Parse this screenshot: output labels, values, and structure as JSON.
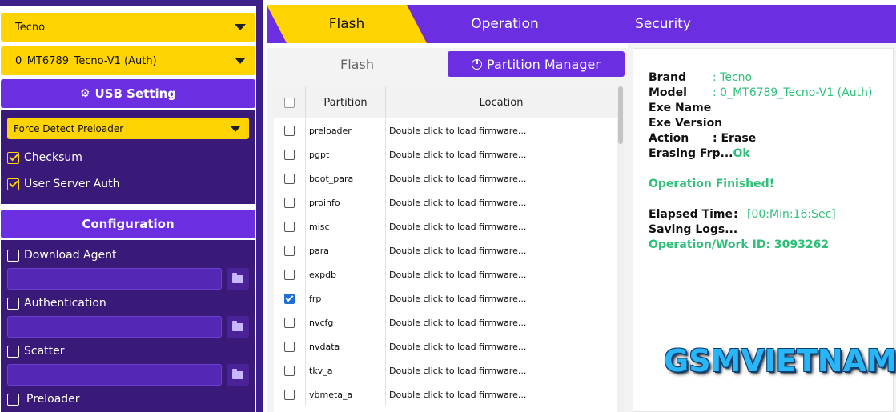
{
  "left": {
    "brand_select": "Tecno",
    "model_select": "0_MT6789_Tecno-V1 (Auth)",
    "usb_setting": "USB Setting",
    "detect_select": "Force Detect Preloader",
    "checksum": "Checksum",
    "user_server_auth": "User Server Auth",
    "configuration": "Configuration",
    "download_agent": "Download Agent",
    "authentication": "Authentication",
    "scatter": "Scatter",
    "preloader": "Preloader"
  },
  "tabs": {
    "flash": "Flash",
    "operation": "Operation",
    "security": "Security"
  },
  "subtabs": {
    "flash": "Flash",
    "partition_manager": "Partition Manager"
  },
  "table": {
    "headers": {
      "partition": "Partition",
      "location": "Location"
    },
    "rows": [
      {
        "partition": "preloader",
        "location": "Double click to load firmware...",
        "checked": false
      },
      {
        "partition": "pgpt",
        "location": "Double click to load firmware...",
        "checked": false
      },
      {
        "partition": "boot_para",
        "location": "Double click to load firmware...",
        "checked": false
      },
      {
        "partition": "proinfo",
        "location": "Double click to load firmware...",
        "checked": false
      },
      {
        "partition": "misc",
        "location": "Double click to load firmware...",
        "checked": false
      },
      {
        "partition": "para",
        "location": "Double click to load firmware...",
        "checked": false
      },
      {
        "partition": "expdb",
        "location": "Double click to load firmware...",
        "checked": false
      },
      {
        "partition": "frp",
        "location": "Double click to load firmware...",
        "checked": true
      },
      {
        "partition": "nvcfg",
        "location": "Double click to load firmware...",
        "checked": false
      },
      {
        "partition": "nvdata",
        "location": "Double click to load firmware...",
        "checked": false
      },
      {
        "partition": "tkv_a",
        "location": "Double click to load firmware...",
        "checked": false
      },
      {
        "partition": "vbmeta_a",
        "location": "Double click to load firmware...",
        "checked": false
      }
    ]
  },
  "log": {
    "brand_key": "Brand",
    "brand_val": ": Tecno",
    "model_key": "Model",
    "model_val": ": 0_MT6789_Tecno-V1 (Auth)",
    "exe_name_key": "Exe Name",
    "exe_version_key": "Exe Version",
    "action_key": "Action",
    "action_val": ": Erase",
    "erasing_key": "Erasing Frp...",
    "erasing_val": "Ok",
    "finished": "Operation Finished!",
    "elapsed_key": "Elapsed Time",
    "elapsed_sep": ":",
    "elapsed_val": "[00:Min:16:Sec]",
    "saving": "Saving Logs...",
    "work_id": "Operation/Work ID: 3093262"
  },
  "watermark": "GSMVIETNAM",
  "colors": {
    "purple": "#6b2ee0",
    "yellow": "#ffd400",
    "green": "#2fbf7a"
  }
}
